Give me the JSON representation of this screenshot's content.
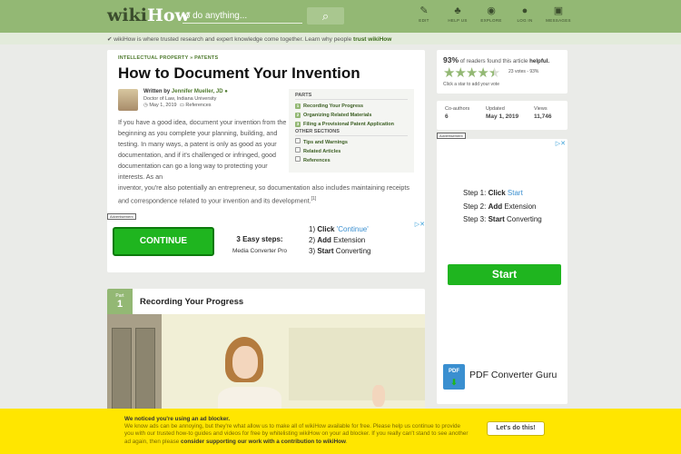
{
  "header": {
    "logo_wiki": "wiki",
    "logo_how": "How",
    "search_placeholder": "to do anything...",
    "nav": [
      {
        "label": "EDIT",
        "icon": "pencil-icon",
        "glyph": "✎"
      },
      {
        "label": "HELP US",
        "icon": "sprout-icon",
        "glyph": "♣"
      },
      {
        "label": "EXPLORE",
        "icon": "compass-icon",
        "glyph": "◉"
      },
      {
        "label": "LOG IN",
        "icon": "user-icon",
        "glyph": "●"
      },
      {
        "label": "MESSAGES",
        "icon": "chat-icon",
        "glyph": "▣"
      }
    ]
  },
  "trust": {
    "text": "wikiHow is where trusted research and expert knowledge come together. Learn why people ",
    "link": "trust wikiHow"
  },
  "article": {
    "breadcrumb": [
      "INTELLECTUAL PROPERTY",
      "PATENTS"
    ],
    "title": "How to Document Your Invention",
    "author_prefix": "Written by ",
    "author": "Jennifer Mueller, JD",
    "credential": "Doctor of Law, Indiana University",
    "date": "May 1, 2019",
    "references_label": "References",
    "intro_a": "If you have a good idea, document your invention from the beginning as you complete your planning, building, and testing. In many ways, a patent is only as good as your documentation, and if it's challenged or infringed, good documentation can go a long way to protecting your interests. As an",
    "intro_b": "inventor, you're also potentially an entrepreneur, so documentation also includes maintaining receipts and correspondence related to your invention and its development.",
    "cite": "[1]"
  },
  "toc": {
    "parts_heading": "PARTS",
    "parts": [
      "Recording Your Progress",
      "Organizing Related Materials",
      "Filing a Provisional Patent Application"
    ],
    "other_heading": "OTHER SECTIONS",
    "other": [
      "Tips and Warnings",
      "Related Articles",
      "References"
    ]
  },
  "ad1": {
    "label": "Advertisement",
    "button": "CONTINUE",
    "steps_title": "3 Easy steps:",
    "brand": "Media Converter Pro",
    "steps": [
      {
        "n": "1) ",
        "b": "Click ",
        "r": "'Continue'"
      },
      {
        "n": "2) ",
        "b": "Add ",
        "r": "Extension"
      },
      {
        "n": "3) ",
        "b": "Start ",
        "r": "Converting"
      }
    ]
  },
  "part1": {
    "label": "Part",
    "number": "1",
    "title": "Recording Your Progress"
  },
  "helpful": {
    "percent": "93%",
    "text": " of readers found this article ",
    "bold": "helpful.",
    "rating": 4.5,
    "votes": "23 votes - 93%",
    "hint": "Click a star to add your vote"
  },
  "stats": [
    {
      "label": "Co-authors",
      "value": "6"
    },
    {
      "label": "Updated",
      "value": "May 1, 2019"
    },
    {
      "label": "Views",
      "value": "11,746"
    }
  ],
  "ad2": {
    "label": "Advertisement",
    "steps": [
      {
        "n": "Step 1: ",
        "b": "Click ",
        "r": "Start"
      },
      {
        "n": "Step 2: ",
        "b": "Add ",
        "r": "Extension"
      },
      {
        "n": "Step 3: ",
        "b": "Start ",
        "r": "Converting"
      }
    ],
    "button": "Start",
    "brand": "PDF Converter Guru"
  },
  "adblock": {
    "title": "We noticed you're using an ad blocker.",
    "text": "We know ads can be annoying, but they're what allow us to make all of wikiHow available for free. Please help us continue to provide you with our trusted how-to guides and videos for free by whitelisting wikiHow on your ad blocker. If you really can't stand to see another ad again, then please ",
    "bold": "consider supporting our work with a contribution to wikiHow",
    "end": ".",
    "button": "Let's do this!"
  },
  "colors": {
    "brand_green": "#93b874",
    "ad_yellow": "#ffe600",
    "continue_green": "#1fb51f"
  }
}
